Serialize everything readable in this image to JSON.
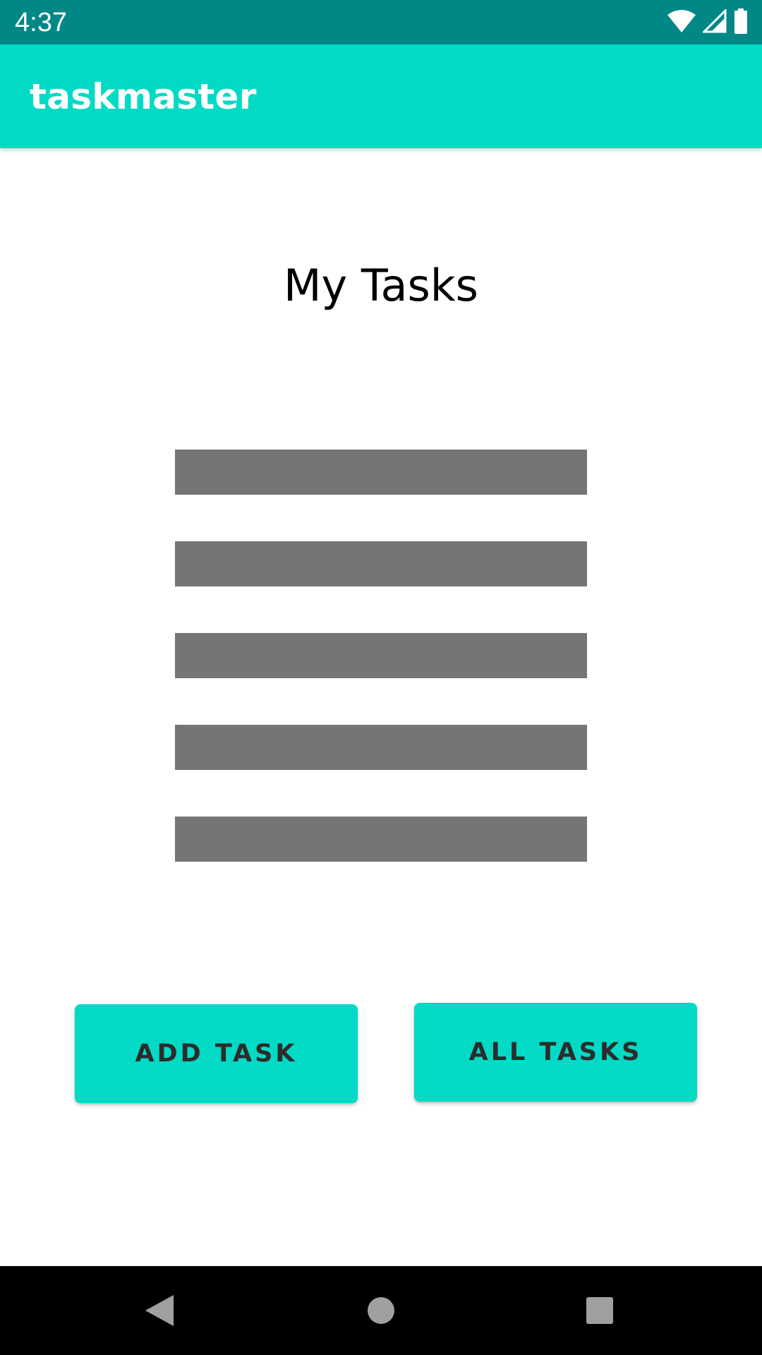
{
  "status_bar": {
    "time": "4:37",
    "icons": [
      "wifi-icon",
      "signal-icon",
      "battery-icon"
    ],
    "background": "#018786"
  },
  "app_bar": {
    "title": "taskmaster",
    "background": "#03DAC5"
  },
  "main": {
    "heading": "My Tasks",
    "task_placeholders": 5,
    "placeholder_color": "#757575"
  },
  "buttons": {
    "add_task": "ADD TASK",
    "all_tasks": "ALL TASKS",
    "color": "#03DAC5"
  },
  "nav_bar": {
    "items": [
      "back-icon",
      "home-icon",
      "recents-icon"
    ]
  }
}
